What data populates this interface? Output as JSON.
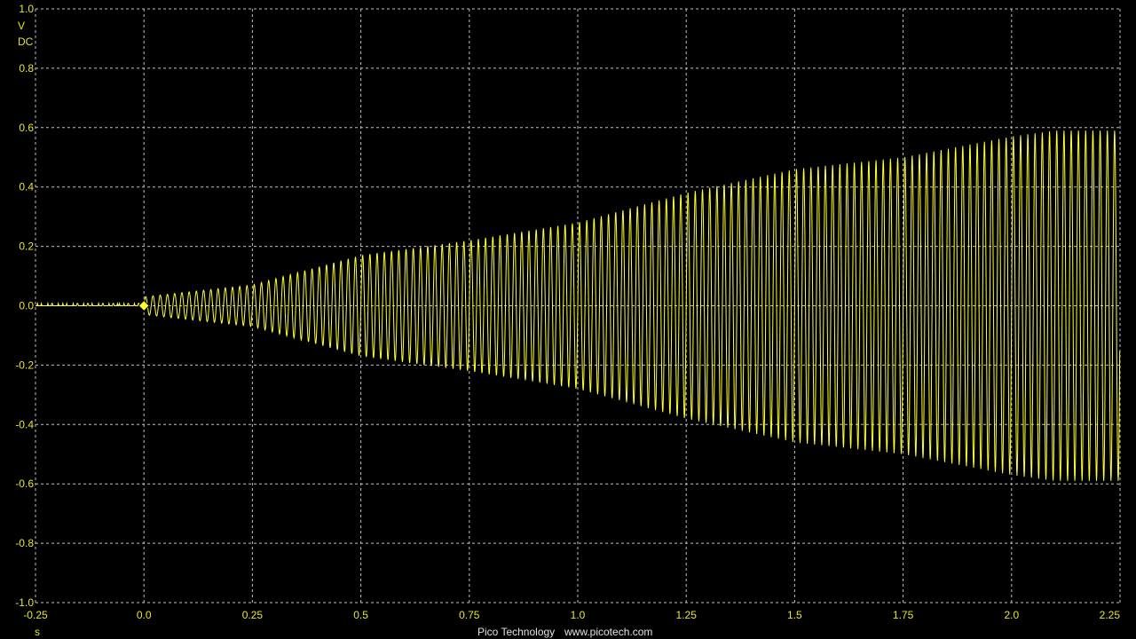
{
  "colors": {
    "background": "#000000",
    "grid": "#bfbfbf",
    "trace": "#ffff33",
    "axis_text": "#e6e62e",
    "footer_text": "#e0e0e0"
  },
  "axis": {
    "y_unit": "V",
    "y_coupling": "DC",
    "x_unit": "s"
  },
  "footer": {
    "brand": "Pico Technology",
    "url": "www.picotech.com"
  },
  "chart_data": {
    "type": "line",
    "title": "",
    "xlabel": "s",
    "ylabel": "V",
    "xlim": [
      -0.25,
      2.25
    ],
    "ylim": [
      -1.0,
      1.0
    ],
    "grid": true,
    "x_ticks": [
      "-0.25",
      "0.0",
      "0.25",
      "0.5",
      "0.75",
      "1.0",
      "1.25",
      "1.5",
      "1.75",
      "2.0",
      "2.25"
    ],
    "y_ticks": [
      "1.0",
      "0.8",
      "0.6",
      "0.4",
      "0.2",
      "0.0",
      "-0.2",
      "-0.4",
      "-0.6",
      "-0.8",
      "-1.0"
    ],
    "trigger_marker": {
      "x": 0.0,
      "y": 0.0
    },
    "series": [
      {
        "envelope_x": [
          -0.25,
          0.0,
          0.25,
          0.5,
          0.75,
          1.0,
          1.25,
          1.5,
          1.75,
          2.0,
          2.1,
          2.25
        ],
        "envelope_y": [
          0.01,
          0.03,
          0.07,
          0.17,
          0.22,
          0.28,
          0.38,
          0.46,
          0.5,
          0.57,
          0.59,
          0.59
        ],
        "cycles_per_second": [
          60,
          60
        ]
      }
    ]
  }
}
